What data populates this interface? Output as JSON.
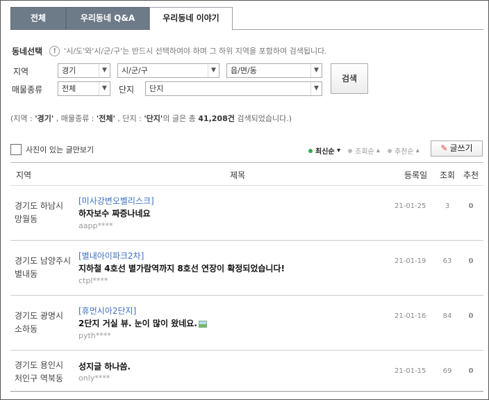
{
  "tabs": [
    {
      "label": "전체"
    },
    {
      "label": "우리동네 Q&A"
    },
    {
      "label": "우리동네 이야기"
    }
  ],
  "filter": {
    "title": "동네선택",
    "hint": "'시/도'와'시/군/구'는 반드시 선택하여야 하며 그 하위 지역을 포함하여 검색됩니다.",
    "region_label": "지역",
    "sido": "경기",
    "sigungu": "시/군/구",
    "eupmyeondong": "읍/면/동",
    "type_label": "매물종류",
    "type_value": "전체",
    "complex_label": "단지",
    "complex_value": "단지",
    "search_button": "검색",
    "info_icon": "!"
  },
  "summary": {
    "prefix": "(지역 : ",
    "region": "'경기'",
    "mid1": " , 매물종류 : ",
    "type": "'전체'",
    "mid2": " , 단지 : ",
    "complex": "'단지'",
    "mid3": "의 글은 총 ",
    "count": "41,208건",
    "suffix": " 검색되었습니다.)"
  },
  "controls": {
    "photo_only": "사진이 있는 글만보기",
    "sort_latest": "최신순",
    "sort_views": "조회순",
    "sort_likes": "추천순",
    "write_button": "글쓰기",
    "arrow_down": "▾",
    "arrow_up": "▴"
  },
  "table": {
    "headers": {
      "region": "지역",
      "title": "제목",
      "date": "등록일",
      "views": "조회",
      "likes": "추천"
    },
    "rows": [
      {
        "region": "경기도 하남시 망월동",
        "category": "[미사강변오벨리스크]",
        "title": "하자보수 짜증나네요",
        "author": "aapp****",
        "date": "21-01-25",
        "views": "3",
        "likes": "0"
      },
      {
        "region": "경기도 남양주시 별내동",
        "category": "[별내아이파크2차]",
        "title": "지하철 4호선 별가람역까지 8호선 연장이 확정되었습니다!",
        "author": "ctpl****",
        "date": "21-01-19",
        "views": "63",
        "likes": "0"
      },
      {
        "region": "경기도 광명시 소하동",
        "category": "[휴먼시아2단지]",
        "title": "2단지 거실 뷰. 눈이 많이 왔네요.",
        "author": "pyth****",
        "date": "21-01-16",
        "views": "84",
        "likes": "0"
      },
      {
        "region": "경기도 용인시 처인구 역북동",
        "category": "",
        "title": "성지글 하나씀.",
        "author": "only****",
        "date": "21-01-15",
        "views": "69",
        "likes": "0"
      }
    ]
  }
}
